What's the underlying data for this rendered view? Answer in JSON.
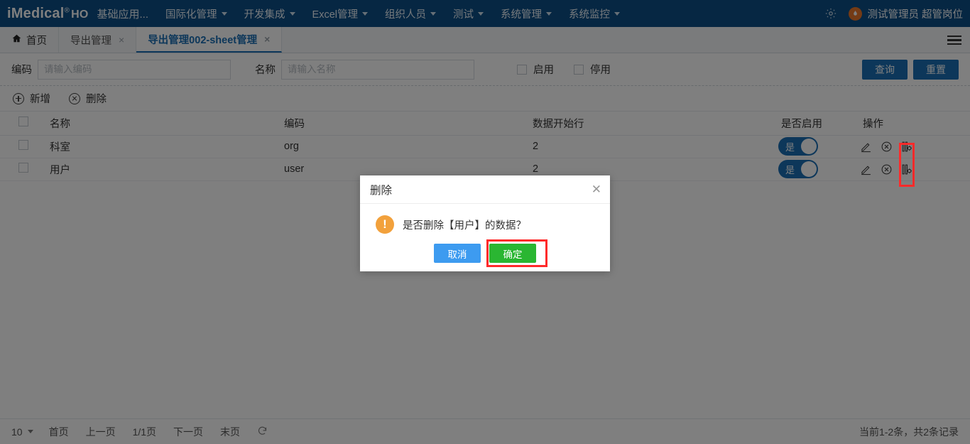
{
  "navbar": {
    "brand": "iMedical",
    "brand_sup": "®",
    "brand_ho": "HO",
    "app_name": "基础应用...",
    "menu": [
      {
        "label": "国际化管理",
        "icon": "chevron-down-icon"
      },
      {
        "label": "开发集成",
        "icon": "chevron-down-icon"
      },
      {
        "label": "Excel管理",
        "icon": "chevron-down-icon"
      },
      {
        "label": "组织人员",
        "icon": "chevron-down-icon"
      },
      {
        "label": "测试",
        "icon": "chevron-down-icon"
      },
      {
        "label": "系统管理",
        "icon": "chevron-down-icon"
      },
      {
        "label": "系统监控",
        "icon": "chevron-down-icon"
      }
    ],
    "settings_icon": "gear-icon",
    "avatar_icon": "user-avatar-icon",
    "user_name": "测试管理员 超管岗位"
  },
  "tabbar": {
    "home_icon": "home-icon",
    "home_label": "首页",
    "tabs": [
      {
        "label": "导出管理",
        "active": false,
        "close": "×"
      },
      {
        "label": "导出管理002-sheet管理",
        "active": true,
        "close": "×"
      }
    ],
    "menu_icon": "hamburger-icon"
  },
  "search": {
    "code_label": "编码",
    "code_placeholder": "请输入编码",
    "code_value": "",
    "name_label": "名称",
    "name_placeholder": "请输入名称",
    "name_value": "",
    "checkbox_enabled": "启用",
    "checkbox_disabled": "停用",
    "query_button": "查询",
    "reset_button": "重置"
  },
  "toolbar": {
    "add_label": "新增",
    "add_icon": "plus-circle-icon",
    "delete_label": "删除",
    "delete_icon": "cross-circle-icon"
  },
  "table": {
    "columns": [
      "名称",
      "编码",
      "数据开始行",
      "是否启用",
      "操作"
    ],
    "rows": [
      {
        "name": "科室",
        "code": "org",
        "start_row": "2",
        "enabled": "是",
        "edit_icon": "pencil-icon",
        "delete_icon": "cross-circle-icon",
        "config_icon": "column-config-icon"
      },
      {
        "name": "用户",
        "code": "user",
        "start_row": "2",
        "enabled": "是",
        "edit_icon": "pencil-icon",
        "delete_icon": "cross-circle-icon",
        "config_icon": "column-config-icon"
      }
    ]
  },
  "footer": {
    "page_size": "10",
    "page_size_icon": "chevron-down-icon",
    "first": "首页",
    "prev": "上一页",
    "indicator": "1/1页",
    "next": "下一页",
    "last": "末页",
    "refresh_icon": "refresh-icon",
    "total": "当前1-2条，共2条记录"
  },
  "modal": {
    "title": "删除",
    "close_icon": "close-icon",
    "warn_icon": "warning-icon",
    "warn_glyph": "!",
    "message": "是否删除【用户】的数据？",
    "cancel_button": "取消",
    "confirm_button": "确定"
  },
  "colors": {
    "navbar": "#0d4e86",
    "accent": "#1a6fb5",
    "confirm_green": "#2ab632",
    "cancel_blue": "#3d9bf0",
    "warn_orange": "#f2a13c",
    "highlight_red": "#ff2a2a"
  }
}
